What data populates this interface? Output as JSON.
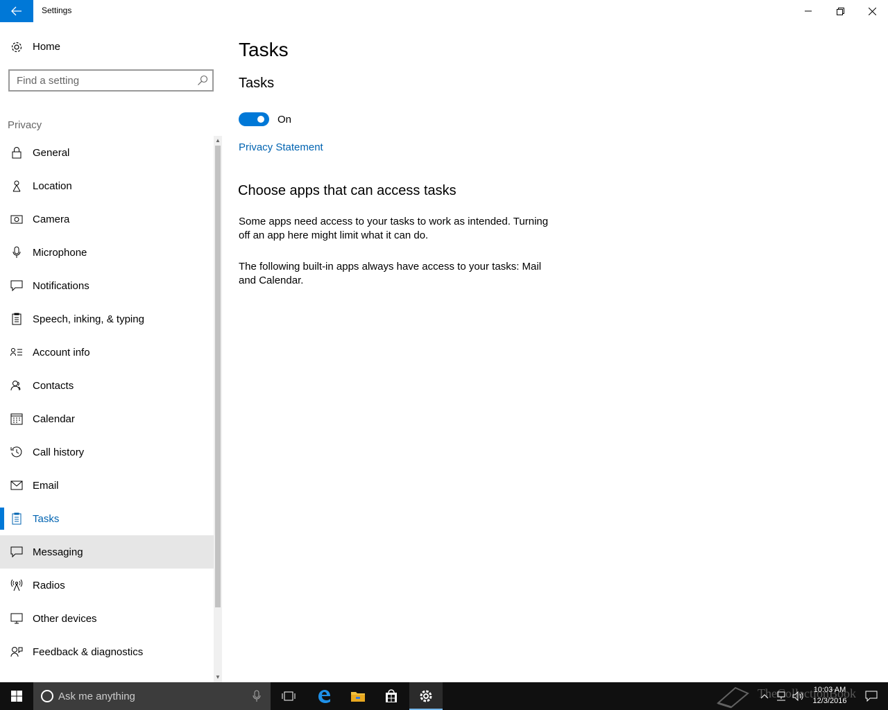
{
  "window": {
    "title": "Settings"
  },
  "sidebar": {
    "home_label": "Home",
    "search_placeholder": "Find a setting",
    "section_title": "Privacy",
    "items": [
      {
        "label": "General",
        "icon": "lock-icon"
      },
      {
        "label": "Location",
        "icon": "location-icon"
      },
      {
        "label": "Camera",
        "icon": "camera-icon"
      },
      {
        "label": "Microphone",
        "icon": "microphone-icon"
      },
      {
        "label": "Notifications",
        "icon": "notifications-icon"
      },
      {
        "label": "Speech, inking, & typing",
        "icon": "speech-icon"
      },
      {
        "label": "Account info",
        "icon": "account-info-icon"
      },
      {
        "label": "Contacts",
        "icon": "contacts-icon"
      },
      {
        "label": "Calendar",
        "icon": "calendar-icon"
      },
      {
        "label": "Call history",
        "icon": "call-history-icon"
      },
      {
        "label": "Email",
        "icon": "email-icon"
      },
      {
        "label": "Tasks",
        "icon": "tasks-icon",
        "selected": true
      },
      {
        "label": "Messaging",
        "icon": "messaging-icon",
        "hover": true
      },
      {
        "label": "Radios",
        "icon": "radios-icon"
      },
      {
        "label": "Other devices",
        "icon": "other-devices-icon"
      },
      {
        "label": "Feedback & diagnostics",
        "icon": "feedback-icon"
      }
    ]
  },
  "main": {
    "page_title": "Tasks",
    "sub_title": "Tasks",
    "toggle_state": "On",
    "privacy_link": "Privacy Statement",
    "choose_heading": "Choose apps that can access tasks",
    "para1": "Some apps need access to your tasks to work as intended. Turning off an app here might limit what it can do.",
    "para2": "The following built-in apps always have access to your tasks: Mail and Calendar."
  },
  "taskbar": {
    "search_placeholder": "Ask me anything",
    "time": "10:03 AM",
    "date": "12/3/2016",
    "watermark": "TheCollectionBook"
  },
  "colors": {
    "accent": "#0078d7",
    "link": "#0063b1",
    "taskbar": "#101010"
  }
}
